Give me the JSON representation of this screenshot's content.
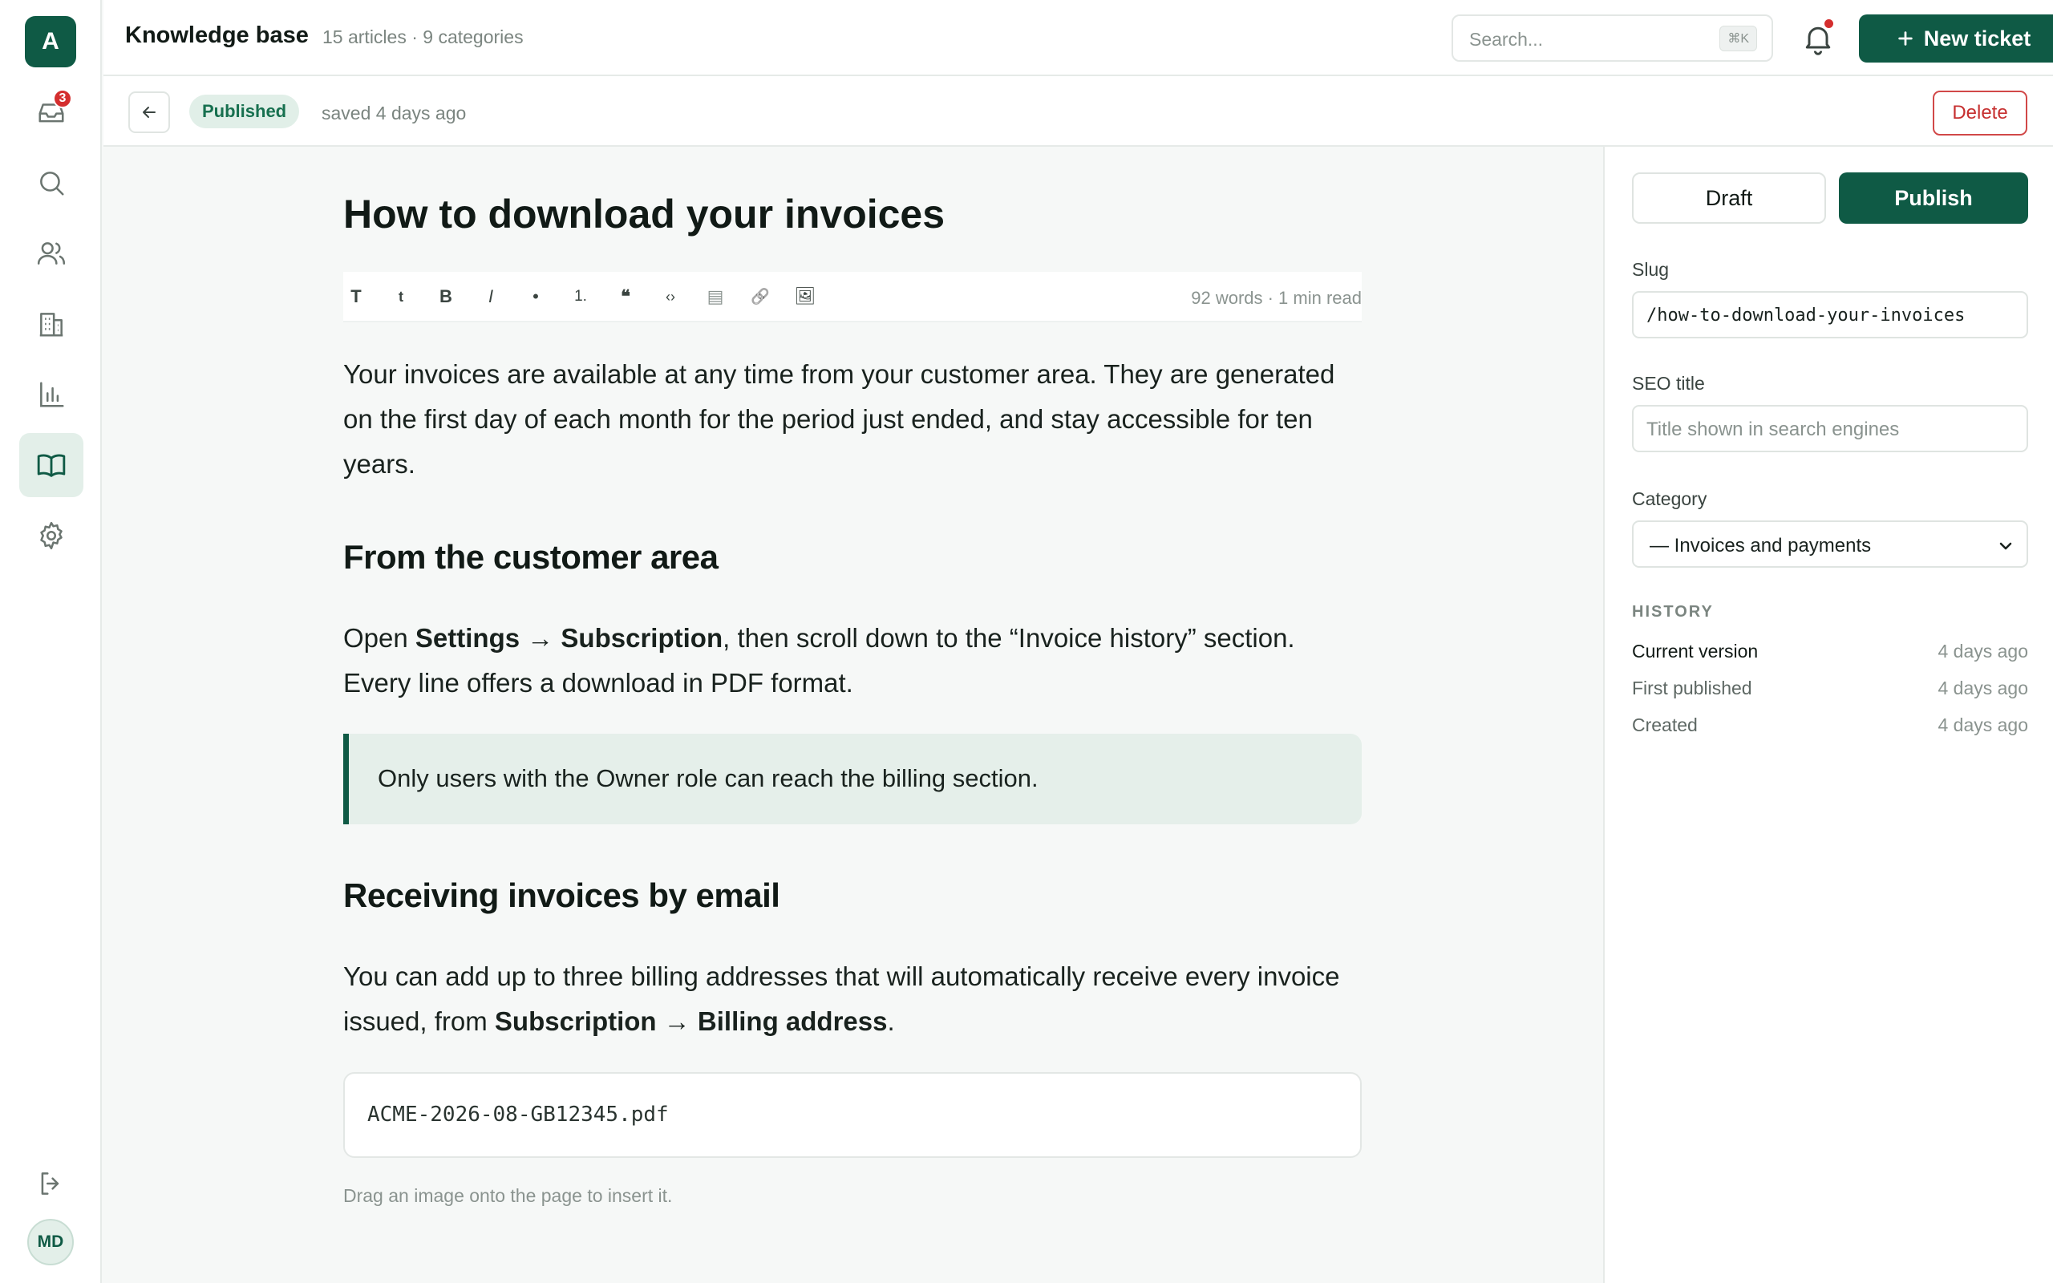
{
  "app": {
    "logo_letter": "A",
    "user_initials": "MD",
    "inbox_badge": "3"
  },
  "header": {
    "title": "Knowledge base",
    "meta": "15 articles · 9 categories",
    "search_placeholder": "Search...",
    "search_shortcut": "⌘K",
    "new_ticket_label": "New ticket"
  },
  "subbar": {
    "status": "Published",
    "saved": "saved 4 days ago",
    "delete_label": "Delete"
  },
  "article": {
    "title": "How to download your invoices",
    "toolbar": [
      "T",
      "t",
      "B",
      "I",
      "•",
      "1.",
      "❝",
      "‹›",
      "▤",
      "🔗",
      "🖼"
    ],
    "word_count": "92 words · 1 min read",
    "p1": "Your invoices are available at any time from your customer area. They are generated on the first day of each month for the period just ended, and stay accessible for ten years.",
    "h2_1": "From the customer area",
    "p2_a": "Open ",
    "p2_b": "Settings → Subscription",
    "p2_c": ", then scroll down to the “Invoice history” section. Every line offers a download in PDF format.",
    "callout": "Only users with the Owner role can reach the billing section.",
    "h2_2": "Receiving invoices by email",
    "p3_a": "You can add up to three billing addresses that will automatically receive every invoice issued, from ",
    "p3_b": "Subscription → Billing address",
    "p3_c": ".",
    "code": "ACME-2026-08-GB12345.pdf",
    "hint": "Drag an image onto the page to insert it."
  },
  "panel": {
    "draft_label": "Draft",
    "publish_label": "Publish",
    "slug_label": "Slug",
    "slug_value": "/how-to-download-your-invoices",
    "seo_label": "SEO title",
    "seo_placeholder": "Title shown in search engines",
    "category_label": "Category",
    "category_value": "— Invoices and payments",
    "history_label": "HISTORY",
    "history": [
      {
        "label": "Current version",
        "when": "4 days ago"
      },
      {
        "label": "First published",
        "when": "4 days ago"
      },
      {
        "label": "Created",
        "when": "4 days ago"
      }
    ]
  },
  "colors": {
    "brand": "#0f5a45",
    "danger": "#d42e2e",
    "accent_bg": "#e3efe9"
  }
}
